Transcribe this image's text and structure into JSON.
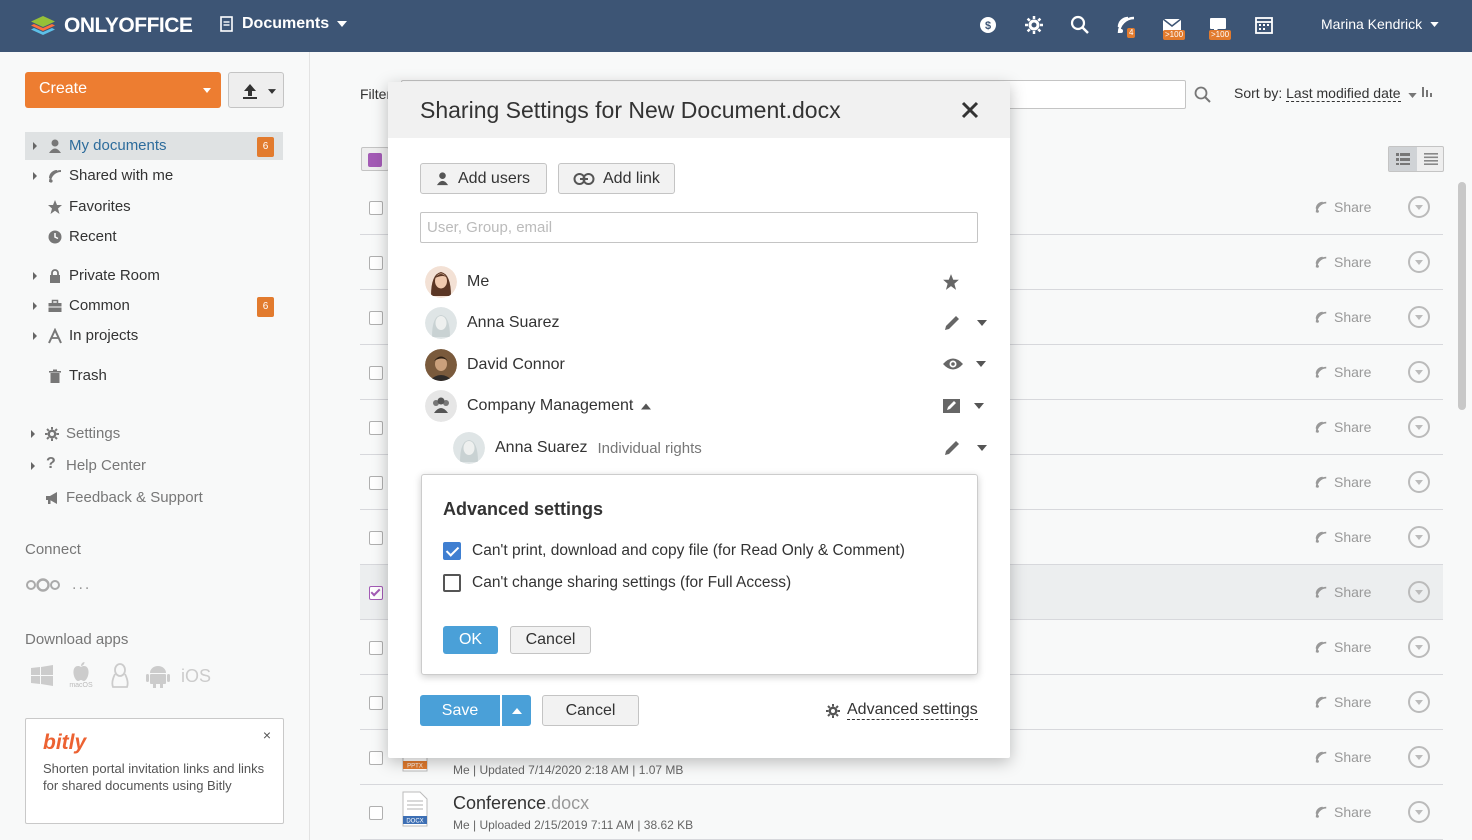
{
  "header": {
    "brand": "ONLYOFFICE",
    "module": "Documents",
    "user": "Marina Kendrick",
    "badges": {
      "feed": "4",
      "mail": ">100",
      "talk": ">100"
    }
  },
  "sidebar": {
    "create_label": "Create",
    "items": [
      {
        "label": "My documents",
        "count": "6"
      },
      {
        "label": "Shared with me"
      },
      {
        "label": "Favorites"
      },
      {
        "label": "Recent"
      },
      {
        "label": "Private Room"
      },
      {
        "label": "Common",
        "count": "6"
      },
      {
        "label": "In projects"
      },
      {
        "label": "Trash"
      },
      {
        "label": "Settings"
      },
      {
        "label": "Help Center"
      },
      {
        "label": "Feedback & Support"
      }
    ],
    "connect_title": "Connect",
    "download_title": "Download apps",
    "ios_label": "iOS",
    "macos_label": "macOS",
    "bitly": {
      "logo": "bitly",
      "text": "Shorten portal invitation links and links for shared documents using Bitly"
    }
  },
  "main": {
    "filter_label": "Filter",
    "sort_prefix": "Sort by:",
    "sort_value": "Last modified date",
    "share_label": "Share",
    "files": [
      {
        "name": "",
        "ext": "",
        "meta": "Me | Updated 7/14/2020 2:18 AM | 1.07 MB",
        "type": "PPTX"
      },
      {
        "name": "Conference",
        "ext": ".docx",
        "meta": "Me | Uploaded 2/15/2019 7:11 AM | 38.62 KB",
        "type": "DOCX"
      }
    ]
  },
  "dialog": {
    "title": "Sharing Settings for New Document.docx",
    "add_users": "Add users",
    "add_link": "Add link",
    "search_placeholder": "User, Group, email",
    "people": [
      {
        "name": "Me"
      },
      {
        "name": "Anna Suarez"
      },
      {
        "name": "David Connor"
      },
      {
        "name": "Company Management"
      },
      {
        "name": "Anna Suarez",
        "note": "Individual rights"
      }
    ],
    "save": "Save",
    "cancel": "Cancel",
    "advanced_link": "Advanced settings"
  },
  "advanced": {
    "title": "Advanced settings",
    "options": [
      {
        "label": "Can't print, download and copy file (for Read Only & Comment)",
        "checked": true
      },
      {
        "label": "Can't change sharing settings (for Full Access)",
        "checked": false
      }
    ],
    "ok": "OK",
    "cancel": "Cancel"
  },
  "colors": {
    "topbar": "#3d5575",
    "create": "#ed7d31",
    "badge": "#e27b2e",
    "primary": "#4aa0d8",
    "checkbox_accent": "#a35bb5"
  }
}
